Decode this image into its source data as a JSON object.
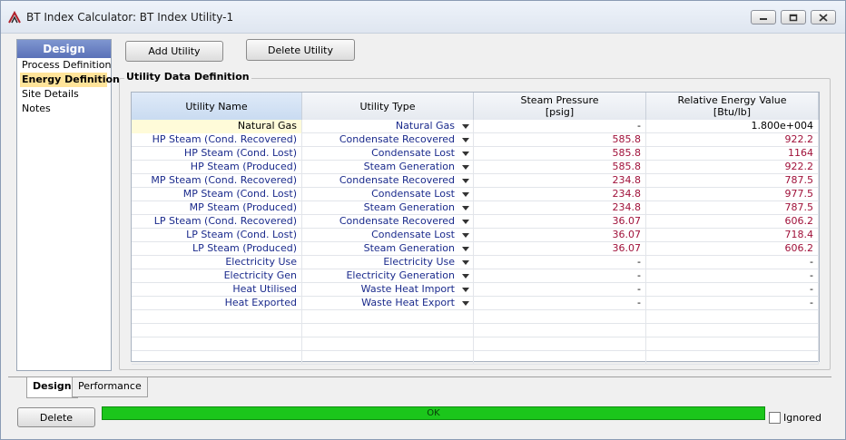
{
  "window": {
    "title": "BT Index Calculator: BT Index Utility-1",
    "controls": [
      "minimize-icon",
      "restore-icon",
      "close-icon"
    ]
  },
  "nav": {
    "header": "Design",
    "items": [
      {
        "label": "Process Definition",
        "active": false
      },
      {
        "label": "Energy Definition",
        "active": true
      },
      {
        "label": "Site Details",
        "active": false
      },
      {
        "label": "Notes",
        "active": false
      }
    ]
  },
  "toolbar": {
    "add_label": "Add Utility",
    "delete_label": "Delete Utility"
  },
  "group": {
    "title": "Utility Data Definition"
  },
  "table": {
    "columns": [
      {
        "line1": "Utility Name",
        "line2": ""
      },
      {
        "line1": "Utility Type",
        "line2": ""
      },
      {
        "line1": "Steam Pressure",
        "line2": "[psig]"
      },
      {
        "line1": "Relative Energy Value",
        "line2": "[Btu/lb]"
      }
    ],
    "rows": [
      {
        "name": "Natural Gas",
        "type": "Natural Gas",
        "pressure": "-",
        "energy": "1.800e+004"
      },
      {
        "name": "HP Steam (Cond. Recovered)",
        "type": "Condensate Recovered",
        "pressure": "585.8",
        "energy": "922.2"
      },
      {
        "name": "HP Steam (Cond. Lost)",
        "type": "Condensate Lost",
        "pressure": "585.8",
        "energy": "1164"
      },
      {
        "name": "HP Steam (Produced)",
        "type": "Steam Generation",
        "pressure": "585.8",
        "energy": "922.2"
      },
      {
        "name": "MP Steam (Cond. Recovered)",
        "type": "Condensate Recovered",
        "pressure": "234.8",
        "energy": "787.5"
      },
      {
        "name": "MP Steam (Cond. Lost)",
        "type": "Condensate Lost",
        "pressure": "234.8",
        "energy": "977.5"
      },
      {
        "name": "MP Steam (Produced)",
        "type": "Steam Generation",
        "pressure": "234.8",
        "energy": "787.5"
      },
      {
        "name": "LP Steam (Cond. Recovered)",
        "type": "Condensate Recovered",
        "pressure": "36.07",
        "energy": "606.2"
      },
      {
        "name": "LP Steam (Cond. Lost)",
        "type": "Condensate Lost",
        "pressure": "36.07",
        "energy": "718.4"
      },
      {
        "name": "LP Steam (Produced)",
        "type": "Steam Generation",
        "pressure": "36.07",
        "energy": "606.2"
      },
      {
        "name": "Electricity Use",
        "type": "Electricity Use",
        "pressure": "-",
        "energy": "-"
      },
      {
        "name": "Electricity Gen",
        "type": "Electricity Generation",
        "pressure": "-",
        "energy": "-"
      },
      {
        "name": "Heat Utilised",
        "type": "Waste Heat Import",
        "pressure": "-",
        "energy": "-"
      },
      {
        "name": "Heat Exported",
        "type": "Waste Heat Export",
        "pressure": "-",
        "energy": "-"
      }
    ],
    "empty_rows": 4
  },
  "tabs": [
    {
      "label": "Design",
      "active": true
    },
    {
      "label": "Performance",
      "active": false
    }
  ],
  "footer": {
    "delete_label": "Delete",
    "status": "OK",
    "status_color": "#1bc61b",
    "ignored_label": "Ignored",
    "ignored_checked": false
  },
  "colors": {
    "name_text": "#1a2a8c",
    "value_text": "#a0113a",
    "nav_active": "#ffe49a",
    "nav_header": "#5a71b8"
  }
}
